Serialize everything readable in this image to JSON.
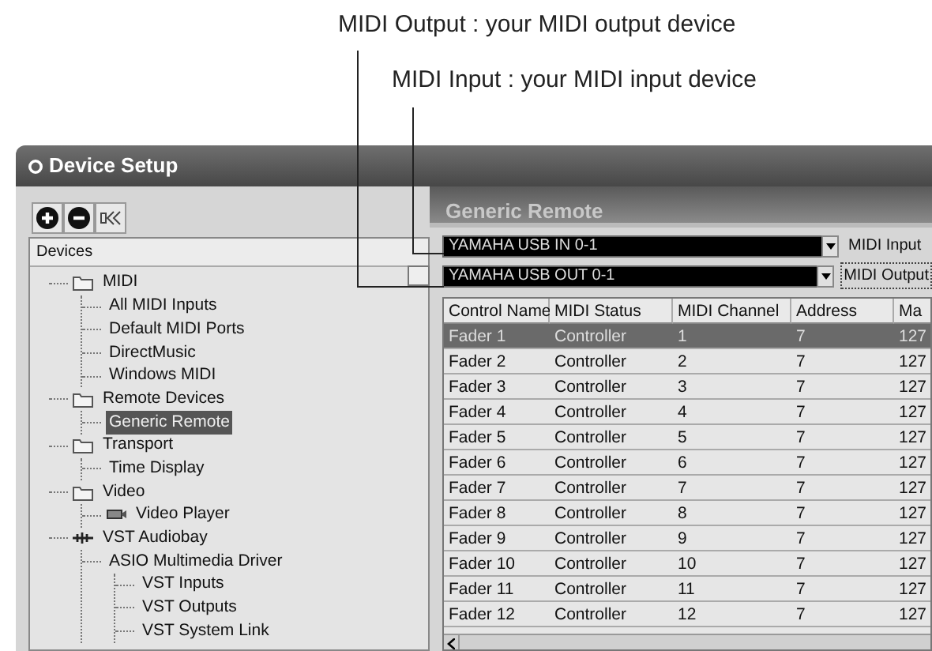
{
  "annotations": [
    {
      "text": "MIDI Output : your MIDI output device"
    },
    {
      "text": "MIDI Input : your MIDI input device"
    }
  ],
  "window": {
    "title": "Device Setup"
  },
  "toolbar": [
    {
      "kind": "add"
    },
    {
      "kind": "remove"
    },
    {
      "kind": "reset"
    }
  ],
  "tree": {
    "header": "Devices",
    "items": [
      {
        "label": "MIDI",
        "kind": "folder",
        "selected": false,
        "children": [
          {
            "label": "All MIDI Inputs",
            "selected": false
          },
          {
            "label": "Default MIDI Ports",
            "selected": false
          },
          {
            "label": "DirectMusic",
            "selected": false
          },
          {
            "label": "Windows MIDI",
            "selected": false
          }
        ]
      },
      {
        "label": "Remote Devices",
        "kind": "folder",
        "selected": false,
        "children": [
          {
            "label": "Generic Remote",
            "selected": true
          }
        ]
      },
      {
        "label": "Transport",
        "kind": "folder",
        "selected": false,
        "children": [
          {
            "label": "Time Display",
            "selected": false
          }
        ]
      },
      {
        "label": "Video",
        "kind": "folder",
        "selected": false,
        "children": [
          {
            "label": "Video Player",
            "kind": "video",
            "selected": false
          }
        ]
      },
      {
        "label": "VST Audiobay",
        "kind": "audio",
        "selected": false,
        "children": [
          {
            "label": "ASIO Multimedia Driver",
            "selected": false,
            "children": [
              {
                "label": "VST Inputs",
                "selected": false
              },
              {
                "label": "VST Outputs",
                "selected": false
              },
              {
                "label": "VST System Link",
                "selected": false
              }
            ]
          }
        ]
      }
    ]
  },
  "panel": {
    "title": "Generic Remote",
    "selectors": [
      {
        "value": "YAMAHA USB IN 0-1",
        "label": "MIDI Input",
        "focused": false
      },
      {
        "value": "YAMAHA USB OUT 0-1",
        "label": "MIDI Output",
        "focused": true
      }
    ],
    "table": {
      "columns": [
        "Control Name",
        "MIDI Status",
        "MIDI Channel",
        "Address",
        "Ma"
      ],
      "rows": [
        {
          "cells": [
            "Fader 1",
            "Controller",
            "1",
            "7",
            "127"
          ],
          "selected": true
        },
        {
          "cells": [
            "Fader 2",
            "Controller",
            "2",
            "7",
            "127"
          ],
          "selected": false
        },
        {
          "cells": [
            "Fader 3",
            "Controller",
            "3",
            "7",
            "127"
          ],
          "selected": false
        },
        {
          "cells": [
            "Fader 4",
            "Controller",
            "4",
            "7",
            "127"
          ],
          "selected": false
        },
        {
          "cells": [
            "Fader 5",
            "Controller",
            "5",
            "7",
            "127"
          ],
          "selected": false
        },
        {
          "cells": [
            "Fader 6",
            "Controller",
            "6",
            "7",
            "127"
          ],
          "selected": false
        },
        {
          "cells": [
            "Fader 7",
            "Controller",
            "7",
            "7",
            "127"
          ],
          "selected": false
        },
        {
          "cells": [
            "Fader 8",
            "Controller",
            "8",
            "7",
            "127"
          ],
          "selected": false
        },
        {
          "cells": [
            "Fader 9",
            "Controller",
            "9",
            "7",
            "127"
          ],
          "selected": false
        },
        {
          "cells": [
            "Fader 10",
            "Controller",
            "10",
            "7",
            "127"
          ],
          "selected": false
        },
        {
          "cells": [
            "Fader 11",
            "Controller",
            "11",
            "7",
            "127"
          ],
          "selected": false
        },
        {
          "cells": [
            "Fader 12",
            "Controller",
            "12",
            "7",
            "127"
          ],
          "selected": false
        }
      ]
    }
  }
}
